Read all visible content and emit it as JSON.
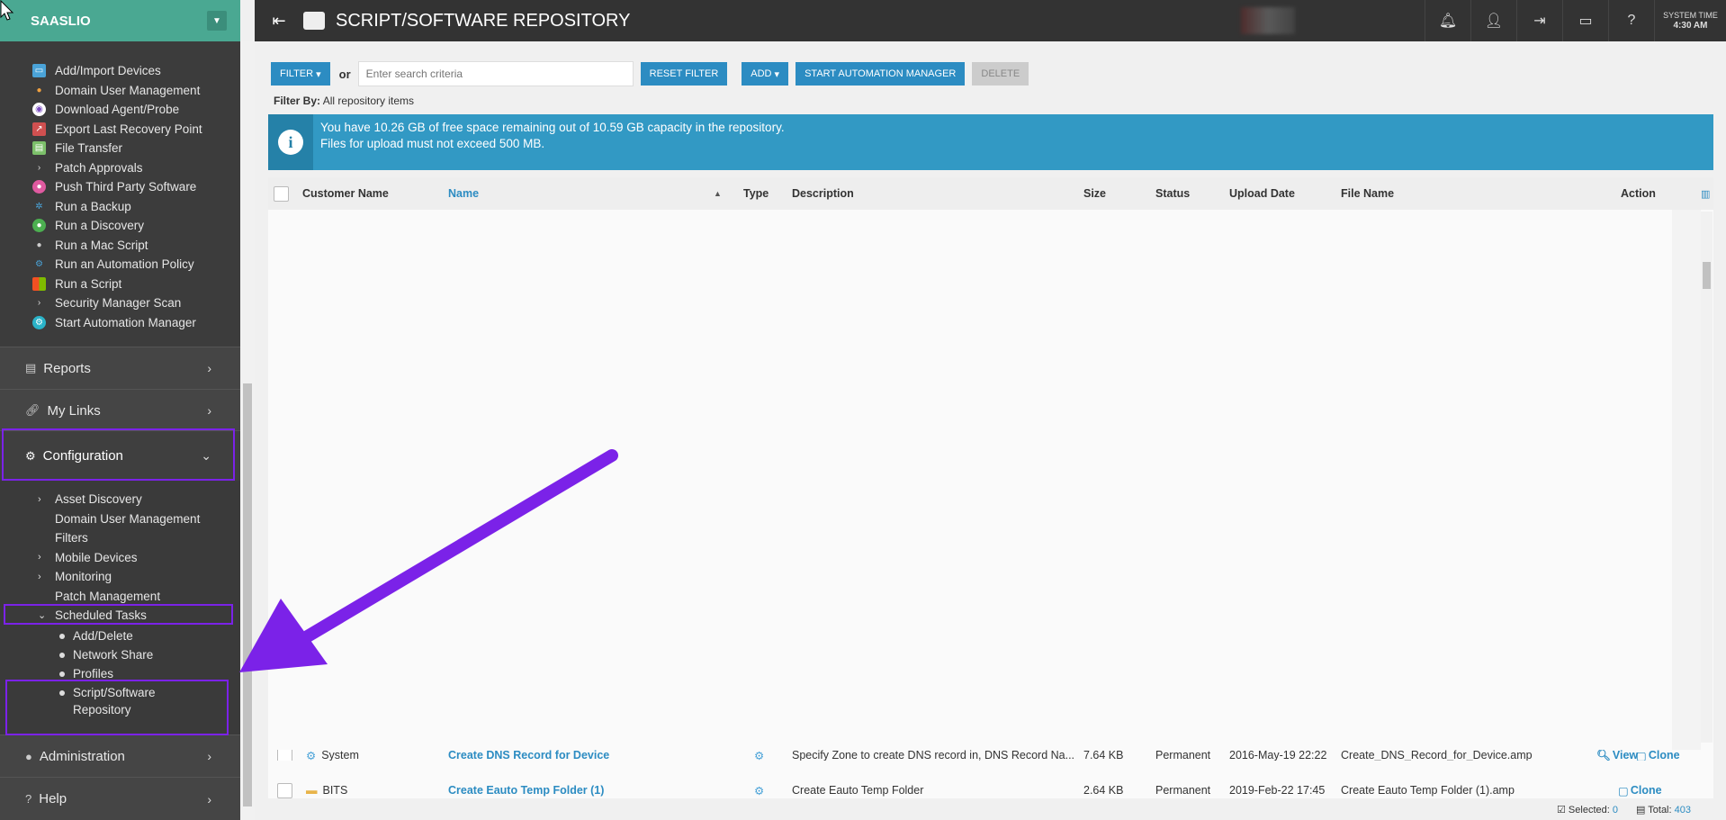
{
  "brand": {
    "name": "SAASLIO"
  },
  "sidebar": {
    "actions": [
      {
        "label": "Add/Import Devices",
        "icon": "monitor-icon"
      },
      {
        "label": "Domain User Management",
        "icon": "users-icon"
      },
      {
        "label": "Download Agent/Probe",
        "icon": "download-icon"
      },
      {
        "label": "Export Last Recovery Point",
        "icon": "export-icon"
      },
      {
        "label": "File Transfer",
        "icon": "file-icon"
      },
      {
        "label": "Patch Approvals",
        "icon": "chevron-right-icon"
      },
      {
        "label": "Push Third Party Software",
        "icon": "push-icon"
      },
      {
        "label": "Run a Backup",
        "icon": "backup-icon"
      },
      {
        "label": "Run a Discovery",
        "icon": "globe-icon"
      },
      {
        "label": "Run a Mac Script",
        "icon": "apple-icon"
      },
      {
        "label": "Run an Automation Policy",
        "icon": "gears-icon"
      },
      {
        "label": "Run a Script",
        "icon": "windows-icon"
      },
      {
        "label": "Security Manager Scan",
        "icon": "chevron-right-icon"
      },
      {
        "label": "Start Automation Manager",
        "icon": "automation-icon"
      }
    ],
    "nav": {
      "reports": "Reports",
      "my_links": "My Links",
      "configuration": "Configuration",
      "administration": "Administration",
      "help": "Help"
    },
    "config_items": [
      {
        "label": "Asset Discovery",
        "caret": "›"
      },
      {
        "label": "Domain User Management",
        "caret": ""
      },
      {
        "label": "Filters",
        "caret": ""
      },
      {
        "label": "Mobile Devices",
        "caret": "›"
      },
      {
        "label": "Monitoring",
        "caret": "›"
      },
      {
        "label": "Patch Management",
        "caret": ""
      },
      {
        "label": "Scheduled Tasks",
        "caret": "⌄"
      }
    ],
    "scheduled_sub": [
      "Add/Delete",
      "Network Share",
      "Profiles",
      "Script/Software",
      "Repository"
    ]
  },
  "topbar": {
    "title": "SCRIPT/SOFTWARE REPOSITORY",
    "system_time_label": "SYSTEM TIME",
    "system_time": "4:30 AM"
  },
  "toolbar": {
    "filter": "FILTER",
    "or": "or",
    "search_placeholder": "Enter search criteria",
    "reset_filter": "RESET FILTER",
    "add": "ADD",
    "start_automation_manager": "START AUTOMATION MANAGER",
    "delete": "DELETE"
  },
  "filterby": {
    "label": "Filter By:",
    "value": "All repository items"
  },
  "info": {
    "line1": "You have 10.26 GB of free space remaining out of 10.59 GB capacity in the repository.",
    "line2": "Files for upload must not exceed 500 MB."
  },
  "grid": {
    "columns": {
      "customer_name": "Customer Name",
      "name": "Name",
      "type": "Type",
      "description": "Description",
      "size": "Size",
      "status": "Status",
      "upload_date": "Upload Date",
      "file_name": "File Name",
      "action": "Action"
    },
    "rows": [
      {
        "customer": "System",
        "name": "Create DNS Record for Device",
        "description": "Specify Zone to create DNS record in, DNS Record Na...",
        "size": "7.64 KB",
        "status": "Permanent",
        "date": "2016-May-19 22:22",
        "file": "Create_DNS_Record_for_Device.amp",
        "actions": [
          "View",
          "Clone"
        ]
      },
      {
        "customer": "BITS",
        "name": "Create Eauto Temp Folder (1)",
        "description": "Create Eauto Temp Folder",
        "size": "2.64 KB",
        "status": "Permanent",
        "date": "2019-Feb-22 17:45",
        "file": "Create Eauto Temp Folder (1).amp",
        "actions": [
          "Clone"
        ]
      }
    ],
    "partial_action": "e"
  },
  "statusbar": {
    "selected_label": "Selected:",
    "selected": "0",
    "total_label": "Total:",
    "total": "403"
  },
  "colors": {
    "accent": "#2c8cc2",
    "brand": "#4aa892",
    "highlight": "#7b22e8"
  }
}
